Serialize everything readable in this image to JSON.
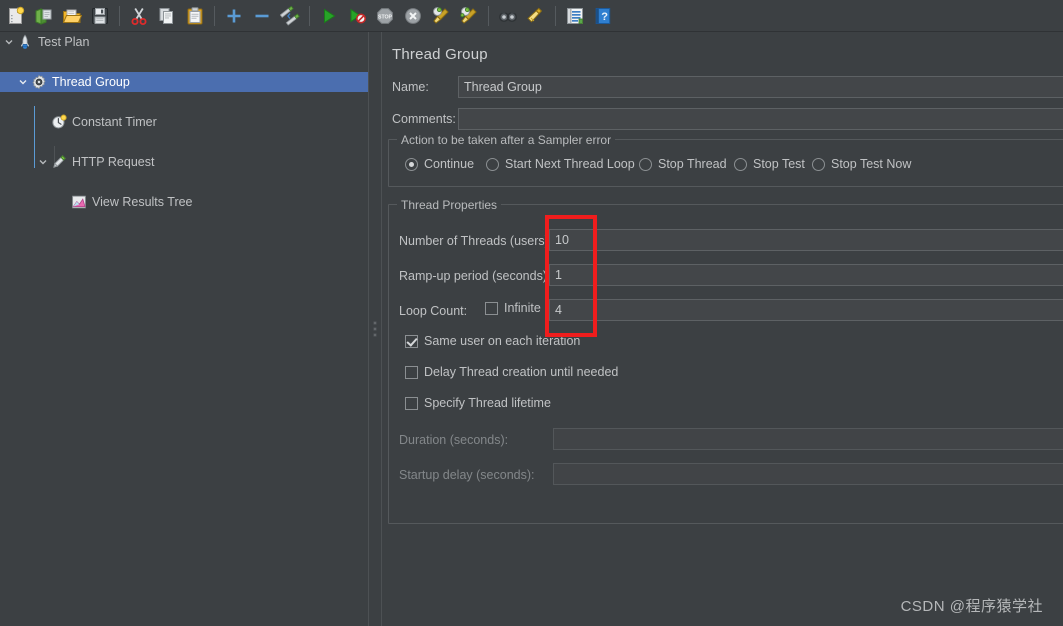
{
  "toolbar": {
    "items": [
      {
        "name": "new-icon",
        "title": "New"
      },
      {
        "name": "templates-icon",
        "title": "Templates"
      },
      {
        "name": "open-icon",
        "title": "Open"
      },
      {
        "name": "save-icon",
        "title": "Save Test Plan"
      },
      {
        "name": "separator",
        "title": ""
      },
      {
        "name": "cut-icon",
        "title": "Cut"
      },
      {
        "name": "copy-icon",
        "title": "Copy"
      },
      {
        "name": "paste-icon",
        "title": "Paste"
      },
      {
        "name": "separator",
        "title": ""
      },
      {
        "name": "expand-all-icon",
        "title": "Expand All"
      },
      {
        "name": "collapse-all-icon",
        "title": "Collapse All"
      },
      {
        "name": "toggle-icon",
        "title": "Toggle"
      },
      {
        "name": "separator",
        "title": ""
      },
      {
        "name": "start-icon",
        "title": "Start"
      },
      {
        "name": "start-no-pauses-icon",
        "title": "Start no pauses"
      },
      {
        "name": "stop-icon",
        "title": "Stop"
      },
      {
        "name": "shutdown-icon",
        "title": "Shutdown"
      },
      {
        "name": "clear-icon",
        "title": "Clear"
      },
      {
        "name": "clear-all-icon",
        "title": "Clear All"
      },
      {
        "name": "separator",
        "title": ""
      },
      {
        "name": "search-icon",
        "title": "Search"
      },
      {
        "name": "reset-search-icon",
        "title": "Reset Search"
      },
      {
        "name": "separator",
        "title": ""
      },
      {
        "name": "function-helper-icon",
        "title": "Function Helper Dialog"
      },
      {
        "name": "help-icon",
        "title": "Help"
      }
    ]
  },
  "tree": {
    "nodes": [
      {
        "label": "Test Plan",
        "depth": 0,
        "icon": "test-plan-icon",
        "twisty": "down",
        "selected": false
      },
      {
        "label": "Thread Group",
        "depth": 1,
        "icon": "thread-group-icon",
        "twisty": "down",
        "selected": true
      },
      {
        "label": "Constant Timer",
        "depth": 2,
        "icon": "constant-timer-icon",
        "twisty": "none",
        "selected": false
      },
      {
        "label": "HTTP Request",
        "depth": 2,
        "icon": "http-request-icon",
        "twisty": "down",
        "selected": false
      },
      {
        "label": "View Results Tree",
        "depth": 3,
        "icon": "view-results-tree-icon",
        "twisty": "none",
        "selected": false
      }
    ]
  },
  "main": {
    "title": "Thread Group",
    "name_label": "Name:",
    "name_value": "Thread Group",
    "comments_label": "Comments:",
    "comments_value": "",
    "sampler_error": {
      "group_title": "Action to be taken after a Sampler error",
      "options": [
        {
          "label": "Continue",
          "selected": true
        },
        {
          "label": "Start Next Thread Loop",
          "selected": false
        },
        {
          "label": "Stop Thread",
          "selected": false
        },
        {
          "label": "Stop Test",
          "selected": false
        },
        {
          "label": "Stop Test Now",
          "selected": false
        }
      ]
    },
    "thread_properties": {
      "group_title": "Thread Properties",
      "num_threads_label": "Number of Threads (users):",
      "num_threads_value": "10",
      "ramp_up_label": "Ramp-up period (seconds):",
      "ramp_up_value": "1",
      "loop_count_label": "Loop Count:",
      "infinite_label": "Infinite",
      "infinite_checked": false,
      "loop_count_value": "4",
      "same_user_label": "Same user on each iteration",
      "same_user_checked": true,
      "delay_thread_label": "Delay Thread creation until needed",
      "delay_thread_checked": false,
      "specify_lifetime_label": "Specify Thread lifetime",
      "specify_lifetime_checked": false,
      "duration_label": "Duration (seconds):",
      "duration_value": "",
      "startup_delay_label": "Startup delay (seconds):",
      "startup_delay_value": ""
    }
  },
  "annotation": {
    "highlight_color": "#f01d1d"
  },
  "watermark": {
    "text": "CSDN @程序猿学社"
  }
}
